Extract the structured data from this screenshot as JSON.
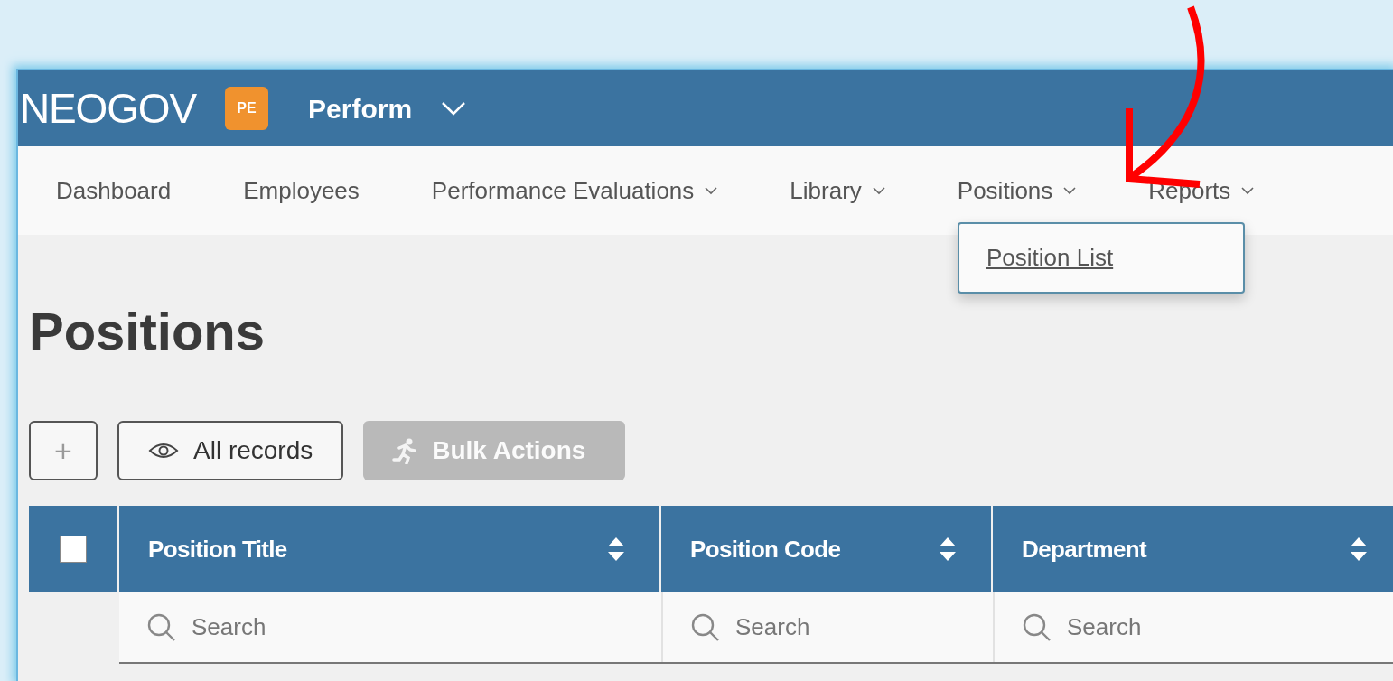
{
  "header": {
    "logo": "NEOGOV",
    "badge": "PE",
    "product": "Perform"
  },
  "nav": {
    "items": [
      {
        "label": "Dashboard",
        "has_caret": false
      },
      {
        "label": "Employees",
        "has_caret": false
      },
      {
        "label": "Performance Evaluations",
        "has_caret": true
      },
      {
        "label": "Library",
        "has_caret": true
      },
      {
        "label": "Positions",
        "has_caret": true,
        "menu": [
          {
            "label": "Position List"
          }
        ]
      },
      {
        "label": "Reports",
        "has_caret": true
      }
    ]
  },
  "page_title": "Positions",
  "toolbar": [
    {
      "kind": "add",
      "label": "+",
      "disabled": false
    },
    {
      "kind": "view",
      "label": "All records",
      "disabled": false
    },
    {
      "kind": "bulk",
      "label": "Bulk Actions",
      "disabled": true
    }
  ],
  "table": {
    "select_all": {
      "checked": false
    },
    "columns": [
      {
        "label": "Position Title",
        "search_placeholder": "Search"
      },
      {
        "label": "Position Code",
        "search_placeholder": "Search"
      },
      {
        "label": "Department",
        "search_placeholder": "Search"
      }
    ]
  }
}
